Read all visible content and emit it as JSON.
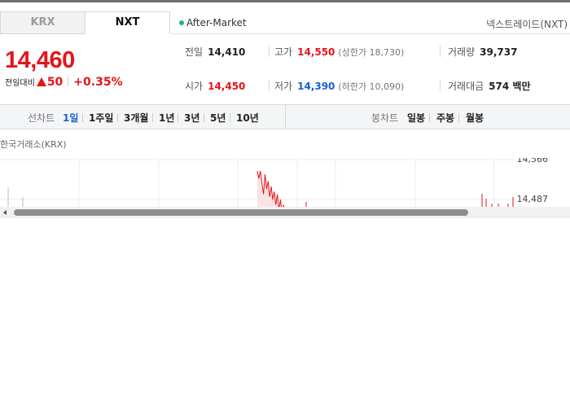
{
  "tabs": [
    {
      "label": "KRX",
      "active": false
    },
    {
      "label": "NXT",
      "active": true
    }
  ],
  "session": {
    "label": "After-Market",
    "dot_color": "#22b573"
  },
  "market_name": "넥스트레이드(NXT)",
  "price": {
    "current": "14,460",
    "change_label": "전일대비",
    "change_amount": "50",
    "change_rate": "+0.35%",
    "direction": "up",
    "color": "#e5141b"
  },
  "stats": {
    "prev_close": {
      "label": "전일",
      "value": "14,410"
    },
    "open": {
      "label": "시가",
      "value": "14,450"
    },
    "high": {
      "label": "고가",
      "value": "14,550",
      "limit": "(상한가 18,730)"
    },
    "low": {
      "label": "저가",
      "value": "14,390",
      "limit": "(하한가 10,090)"
    },
    "volume": {
      "label": "거래량",
      "value": "39,737"
    },
    "amount": {
      "label": "거래대금",
      "value": "574 백만"
    }
  },
  "period_bar": {
    "line_label": "선차트",
    "line_periods": [
      "1일",
      "1주일",
      "3개월",
      "1년",
      "3년",
      "5년",
      "10년"
    ],
    "active_period": "1일",
    "candle_label": "봉차트",
    "candle_periods": [
      "일봉",
      "주봉",
      "월봉"
    ]
  },
  "chart": {
    "source": "한국거래소(KRX)",
    "y_ticks": [
      "14,566",
      "14,487"
    ]
  },
  "chart_data": {
    "type": "line",
    "title": "",
    "xlabel": "",
    "ylabel": "",
    "ylim": [
      14380,
      14580
    ],
    "grid": true,
    "series": [
      {
        "values": [
          14566,
          14530,
          14548,
          14520,
          14500,
          14538,
          14510,
          14525,
          14495,
          14515,
          14490,
          14505,
          14480,
          14500,
          14470,
          14490,
          14465,
          14480,
          14460,
          14470
        ]
      }
    ],
    "y_tick_labels": [
      "14,566",
      "14,487"
    ]
  }
}
